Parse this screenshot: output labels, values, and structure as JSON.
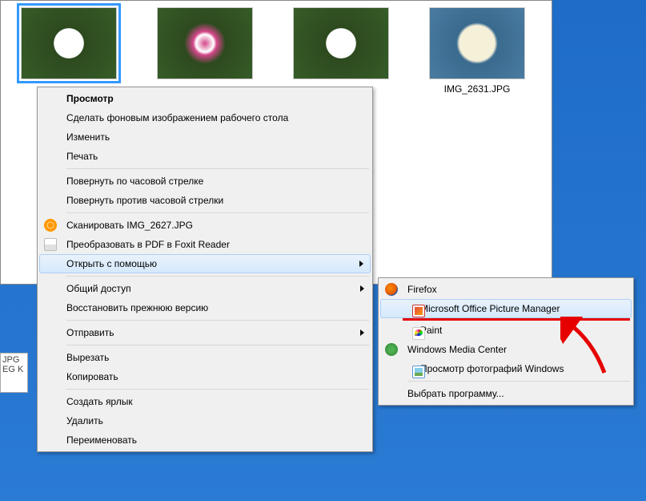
{
  "thumbnails": [
    {
      "label": ""
    },
    {
      "label": ""
    },
    {
      "label": ""
    },
    {
      "label": "IMG_2631.JPG"
    }
  ],
  "partial": {
    "line1": "JPG",
    "line2": "EG   K"
  },
  "contextMenu": {
    "preview": "Просмотр",
    "setWallpaper": "Сделать фоновым изображением рабочего стола",
    "edit": "Изменить",
    "print": "Печать",
    "rotateCW": "Повернуть по часовой стрелке",
    "rotateCCW": "Повернуть против часовой стрелки",
    "scan": "Сканировать IMG_2627.JPG",
    "pdf": "Преобразовать в PDF в Foxit Reader",
    "openWith": "Открыть с помощью",
    "share": "Общий доступ",
    "restore": "Восстановить прежнюю версию",
    "sendTo": "Отправить",
    "cut": "Вырезать",
    "copy": "Копировать",
    "shortcut": "Создать ярлык",
    "delete": "Удалить",
    "rename": "Переименовать"
  },
  "submenu": {
    "firefox": "Firefox",
    "picmgr": "Microsoft Office Picture Manager",
    "paint": "Paint",
    "wmc": "Windows Media Center",
    "photoviewer": "Просмотр фотографий Windows",
    "choose": "Выбрать программу..."
  }
}
